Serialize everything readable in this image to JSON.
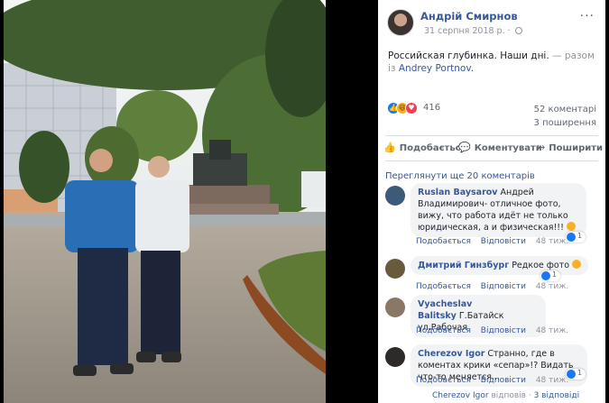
{
  "post": {
    "author": "Андрій Смирнов",
    "date": "31 серпня 2018 р. ·",
    "text": "Российская глубинка. Наши дні.",
    "with_text": " — разом із",
    "tagged": "Andrey Portnov.",
    "more_label": "···"
  },
  "reactions": {
    "count": "416",
    "comments": "52 коментарі",
    "shares": "3 поширення",
    "like_icon": "like-icon",
    "haha_icon": "haha-icon",
    "love_icon": "love-icon"
  },
  "actions": {
    "like": "Подобається",
    "comment": "Коментувати",
    "share": "Поширити"
  },
  "more_comments": "Переглянути ще 20 коментарів",
  "comments": [
    {
      "name": "Ruslan Baysarov",
      "text": "Андрей Владимирович- отличное фото, вижу, что работа идёт не только юридическая, а и физическая!!!",
      "like": "Подобається",
      "reply": "Відповісти",
      "time": "48 тиж.",
      "likes": "1",
      "avatar_color": "#3d5a78"
    },
    {
      "name": "Дмитрий Гинзбург",
      "text": "Редкое фото",
      "like": "Подобається",
      "reply": "Відповісти",
      "time": "48 тиж.",
      "likes": "1",
      "avatar_color": "#6a5a3c"
    },
    {
      "name": "Vyacheslav Balitsky",
      "text": "Г.Батайск ул.Рабочая",
      "like": "Подобається",
      "reply": "Відповісти",
      "time": "48 тиж.",
      "likes": "",
      "avatar_color": "#8a7766"
    },
    {
      "name": "Cherezov Igor",
      "text": "Странно, где в коментах крики «сепар»!? Видать что-то меняется...",
      "like": "Подобається",
      "reply": "Відповісти",
      "time": "48 тиж.",
      "likes": "1",
      "avatar_color": "#2e2a28"
    }
  ],
  "footer": {
    "author": "Cherezov Igor",
    "action": "відповів",
    "replies": "3 відповіді"
  }
}
